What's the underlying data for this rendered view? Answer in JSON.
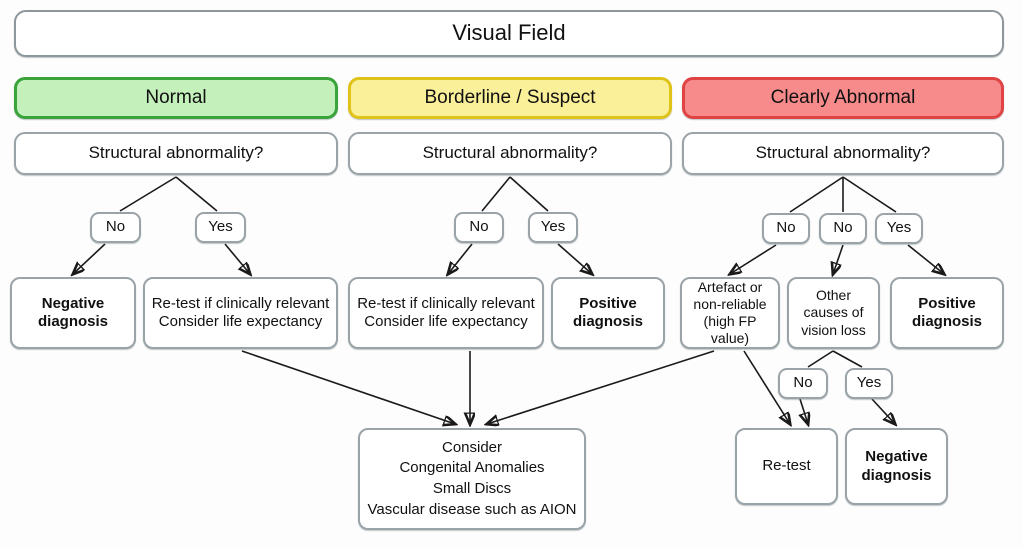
{
  "diagram": {
    "title": "Visual Field",
    "root": {
      "label": "Visual Field"
    },
    "categories": [
      {
        "id": "normal",
        "label": "Normal",
        "fill": "#c3f0bb",
        "stroke": "#3aa33a"
      },
      {
        "id": "borderline",
        "label": "Borderline / Suspect",
        "fill": "#fbf09a",
        "stroke": "#e0c319"
      },
      {
        "id": "abnormal",
        "label": "Clearly Abnormal",
        "fill": "#f78b8b",
        "stroke": "#e04343"
      }
    ],
    "questions": [
      {
        "id": "q-normal",
        "label": "Structural abnormality?"
      },
      {
        "id": "q-borderline",
        "label": "Structural abnormality?"
      },
      {
        "id": "q-abnormal",
        "label": "Structural abnormality?"
      }
    ],
    "branches": {
      "normal_no": "No",
      "normal_yes": "Yes",
      "borderline_no": "No",
      "borderline_yes": "Yes",
      "abnormal_no_artefact": "No",
      "abnormal_no_other": "No",
      "abnormal_yes": "Yes",
      "other_no": "No",
      "other_yes": "Yes"
    },
    "outcomes": {
      "negative_diagnosis_1": {
        "line1": "Negative",
        "line2": "diagnosis"
      },
      "retest_normal": {
        "line1": "Re-test if clinically relevant",
        "line2": "Consider life expectancy"
      },
      "retest_borderline": {
        "line1": "Re-test if clinically relevant",
        "line2": "Consider life expectancy"
      },
      "positive_diagnosis_1": {
        "line1": "Positive",
        "line2": "diagnosis"
      },
      "artefact": {
        "line1": "Artefact or",
        "line2": "non-reliable",
        "line3": "(high FP value)"
      },
      "other_causes": {
        "line1": "Other",
        "line2": "causes of",
        "line3": "vision loss"
      },
      "positive_diagnosis_2": {
        "line1": "Positive",
        "line2": "diagnosis"
      },
      "consider": {
        "line1": "Consider",
        "line2": "Congenital Anomalies",
        "line3": "Small Discs",
        "line4": "Vascular disease such as AION"
      },
      "retest_final": {
        "line1": "Re-test"
      },
      "negative_diagnosis_2": {
        "line1": "Negative",
        "line2": "diagnosis"
      }
    }
  }
}
